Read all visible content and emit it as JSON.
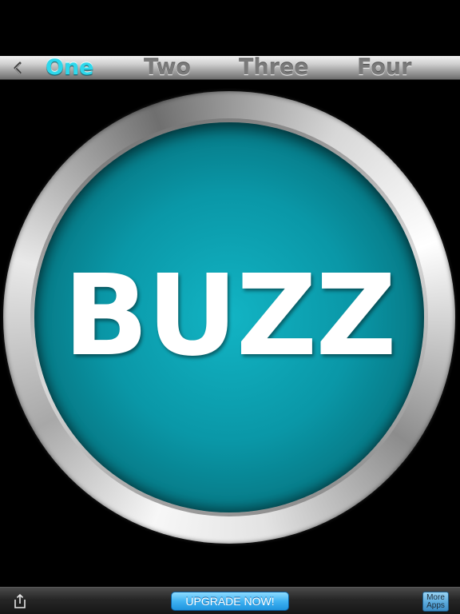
{
  "tabbar": {
    "back_icon": "chevron-left-icon",
    "tabs": [
      {
        "label": "One",
        "active": true
      },
      {
        "label": "Two",
        "active": false
      },
      {
        "label": "Three",
        "active": false
      },
      {
        "label": "Four",
        "active": false
      }
    ],
    "active_color": "#2ed8ec",
    "inactive_color": "#7a7a7a"
  },
  "buzzer": {
    "label": "BUZZ",
    "face_color": "#0a97a7",
    "ring_color": "#c8c8c8"
  },
  "bottombar": {
    "share_icon": "share-icon",
    "upgrade_label": "UPGRADE NOW!",
    "more_apps_line1": "More",
    "more_apps_line2": "Apps"
  }
}
